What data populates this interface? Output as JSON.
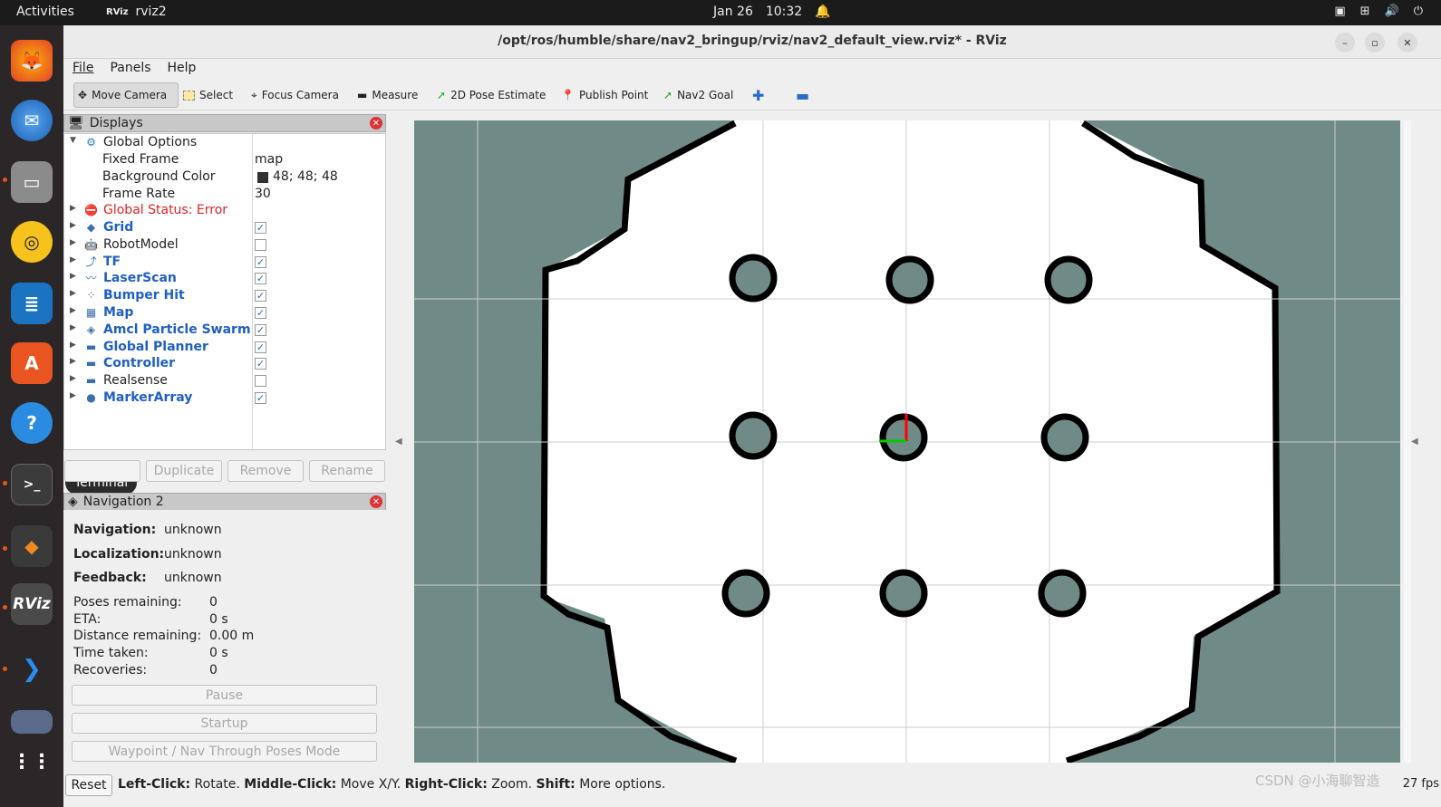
{
  "topbar": {
    "activities": "Activities",
    "app_icon": "RViz",
    "app_name": "rviz2",
    "date": "Jan 26",
    "time": "10:32"
  },
  "window": {
    "title": "/opt/ros/humble/share/nav2_bringup/rviz/nav2_default_view.rviz* - RViz"
  },
  "menu": {
    "file": "File",
    "panels": "Panels",
    "help": "Help"
  },
  "toolbar": {
    "move_camera": "Move Camera",
    "select": "Select",
    "focus_camera": "Focus Camera",
    "measure": "Measure",
    "pose_estimate": "2D Pose Estimate",
    "publish_point": "Publish Point",
    "nav2_goal": "Nav2 Goal"
  },
  "dock": {
    "tooltip": "Terminal",
    "rviz": "RViz"
  },
  "displays": {
    "title": "Displays",
    "global_options": "Global Options",
    "fixed_frame_label": "Fixed Frame",
    "fixed_frame_value": "map",
    "bg_color_label": "Background Color",
    "bg_color_value": "48; 48; 48",
    "frame_rate_label": "Frame Rate",
    "frame_rate_value": "30",
    "global_status": "Global Status: Error",
    "items": [
      {
        "label": "Grid",
        "checked": true
      },
      {
        "label": "RobotModel",
        "checked": false
      },
      {
        "label": "TF",
        "checked": true
      },
      {
        "label": "LaserScan",
        "checked": true
      },
      {
        "label": "Bumper Hit",
        "checked": true
      },
      {
        "label": "Map",
        "checked": true
      },
      {
        "label": "Amcl Particle Swarm",
        "checked": true
      },
      {
        "label": "Global Planner",
        "checked": true
      },
      {
        "label": "Controller",
        "checked": true
      },
      {
        "label": "Realsense",
        "checked": false
      },
      {
        "label": "MarkerArray",
        "checked": true
      }
    ],
    "buttons": {
      "duplicate": "Duplicate",
      "remove": "Remove",
      "rename": "Rename"
    }
  },
  "navigation": {
    "title": "Navigation 2",
    "navigation_label": "Navigation:",
    "navigation_value": "unknown",
    "localization_label": "Localization:",
    "localization_value": "unknown",
    "feedback_label": "Feedback:",
    "feedback_value": "unknown",
    "poses_label": "Poses remaining:",
    "poses_value": "0",
    "eta_label": "ETA:",
    "eta_value": "0 s",
    "distance_label": "Distance remaining:",
    "distance_value": "0.00 m",
    "time_label": "Time taken:",
    "time_value": "0 s",
    "recoveries_label": "Recoveries:",
    "recoveries_value": "0",
    "pause": "Pause",
    "startup": "Startup",
    "waypoint": "Waypoint / Nav Through Poses Mode"
  },
  "status": {
    "reset": "Reset",
    "left_click": "Left-Click:",
    "left_click_desc": "Rotate.",
    "middle_click": "Middle-Click:",
    "middle_click_desc": "Move X/Y.",
    "right_click": "Right-Click:",
    "right_click_desc": "Zoom.",
    "shift": "Shift:",
    "shift_desc": "More options.",
    "fps": "27 fps"
  },
  "watermark": "CSDN @小海聊智造",
  "colors": {
    "map_unknown": "#708b87",
    "map_free": "#ffffff",
    "map_occupied": "#000000",
    "error": "#dd2222",
    "link_blue": "#1f5fc4"
  }
}
